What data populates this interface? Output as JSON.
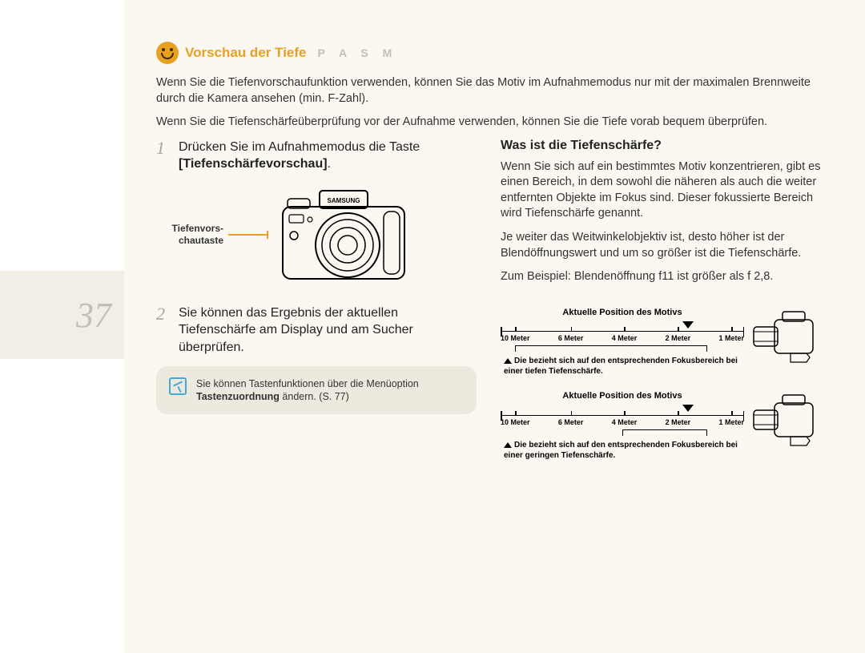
{
  "page_number": "37",
  "header": {
    "title": "Vorschau der Tiefe",
    "modes": "P A S M"
  },
  "intro": {
    "p1": "Wenn Sie die Tiefenvorschaufunktion verwenden, können Sie das Motiv im Aufnahmemodus nur mit der maximalen Brennweite durch die Kamera ansehen (min. F-Zahl).",
    "p2": "Wenn Sie die Tiefenschärfeüberprüfung vor der Aufnahme verwenden, können Sie die Tiefe vorab bequem überprüfen."
  },
  "steps": {
    "s1_num": "1",
    "s1_a": "Drücken Sie im Aufnahmemodus die Taste ",
    "s1_b": "[Tiefenschärfevorschau]",
    "s1_c": ".",
    "camera_label_l1": "Tiefenvors-",
    "camera_label_l2": "chautaste",
    "s2_num": "2",
    "s2": "Sie können das Ergebnis der aktuellen Tiefenschärfe am Display und am Sucher überprüfen."
  },
  "note": {
    "a": "Sie können Tastenfunktionen über die Menüoption ",
    "b": "Tastenzuordnung",
    "c": " ändern. (S. 77)"
  },
  "right": {
    "heading": "Was ist die Tiefenschärfe?",
    "p1": "Wenn Sie sich auf ein bestimmtes Motiv konzentrieren, gibt es einen Bereich, in dem sowohl die näheren als auch die weiter entfernten Objekte im Fokus sind. Dieser fokussierte Bereich wird Tiefenschärfe genannt.",
    "p2": "Je weiter das Weitwinkelobjektiv ist, desto höher ist der Blendöffnungswert und um so größer ist die Tiefenschärfe.",
    "p3": "Zum Beispiel: Blendenöffnung f11 ist größer als f 2,8."
  },
  "diagrams": {
    "title": "Aktuelle Position des Motivs",
    "ticks": [
      "10 Meter",
      "6 Meter",
      "4 Meter",
      "2 Meter",
      "1 Meter"
    ],
    "cap_deep": "Die bezieht sich auf den entsprechenden Fokusbereich bei einer tiefen Tiefenschärfe.",
    "cap_shallow": "Die bezieht sich auf den entsprechenden Fokusbereich bei einer geringen Tiefenschärfe."
  }
}
